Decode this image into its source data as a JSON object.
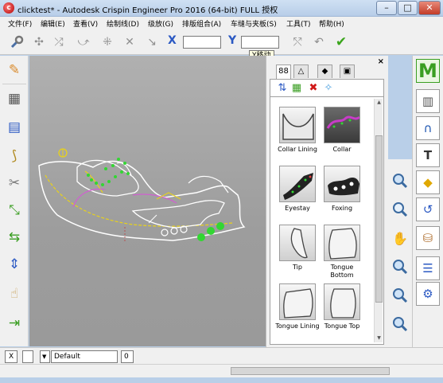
{
  "window": {
    "app_icon_letter": "c",
    "title": "clicktest* - Autodesk Crispin Engineer Pro 2016 (64-bit)  FULL 授权",
    "minimize": "–",
    "maximize": "□",
    "close": "✕"
  },
  "menu": [
    {
      "label": "文件(F)"
    },
    {
      "label": "编辑(E)"
    },
    {
      "label": "查看(V)"
    },
    {
      "label": "绘制线(D)"
    },
    {
      "label": "级放(G)"
    },
    {
      "label": "排版组合(A)"
    },
    {
      "label": "车缝与夹板(S)"
    },
    {
      "label": "工具(T)"
    },
    {
      "label": "帮助(H)"
    }
  ],
  "toolbar": {
    "x_label": "X",
    "x_value": "",
    "y_label": "Y",
    "y_value": "",
    "tooltip": "Y移动"
  },
  "panel": {
    "close_label": "×",
    "tabs": [
      "88",
      "△",
      "◆",
      "▣"
    ],
    "items": [
      {
        "label": "Collar Lining",
        "icon": "collar-lining"
      },
      {
        "label": "Collar",
        "icon": "collar"
      },
      {
        "label": "Eyestay",
        "icon": "eyestay"
      },
      {
        "label": "Foxing",
        "icon": "foxing"
      },
      {
        "label": "Tip",
        "icon": "tip"
      },
      {
        "label": "Tongue Bottom",
        "icon": "tongue-bottom"
      },
      {
        "label": "Tongue Lining",
        "icon": "tongue-lining"
      },
      {
        "label": "Tongue Top",
        "icon": "tongue-top"
      }
    ]
  },
  "right_panel": {
    "logo_letter": "M"
  },
  "status": {
    "x_button": "X",
    "layer_value": "Default",
    "count": "0"
  },
  "colors": {
    "accent_blue": "#2b59c3",
    "canvas_bg": "#a6a6a6",
    "pattern_green": "#33d633",
    "pattern_yellow": "#e8d21a",
    "logo_green": "#3a9e22"
  }
}
